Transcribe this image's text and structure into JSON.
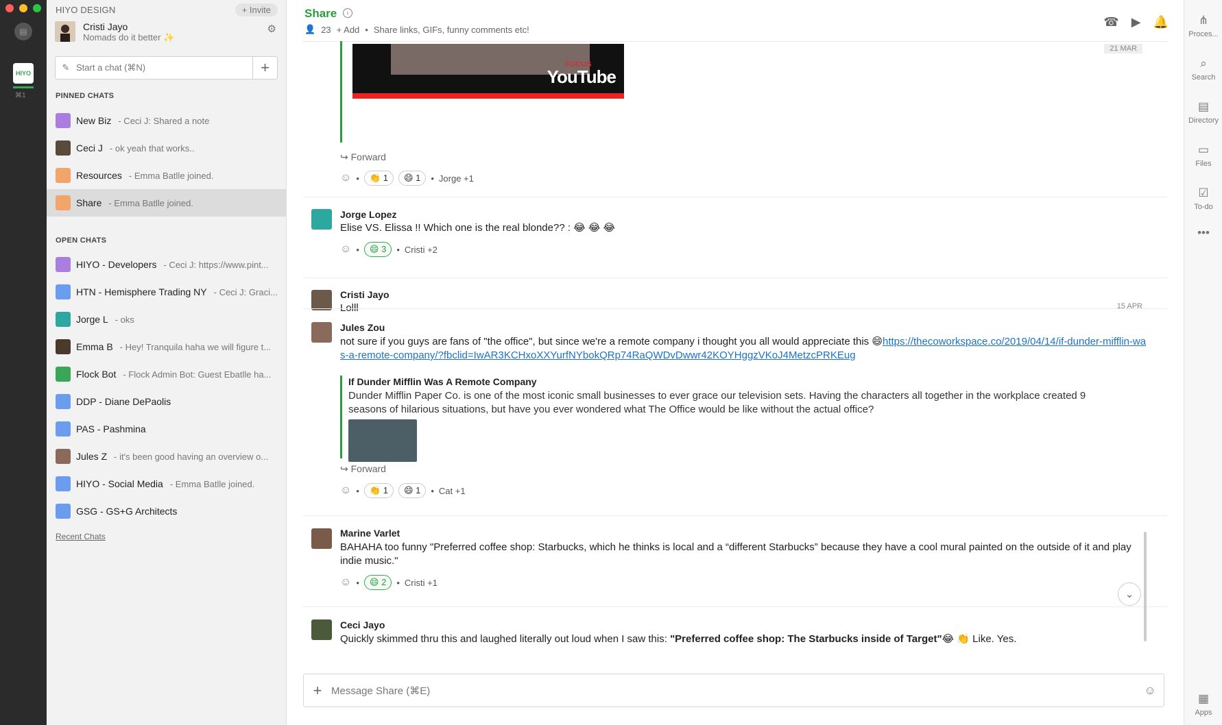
{
  "team": {
    "name": "HIYO DESIGN",
    "invite": "+ Invite",
    "shortcut": "⌘1"
  },
  "user": {
    "name": "Cristi Jayo",
    "status": "Nomads do it better ✨"
  },
  "start_chat": {
    "placeholder": "Start a chat (⌘N)"
  },
  "pinned": {
    "title": "PINNED CHATS",
    "items": [
      {
        "name": "New Biz",
        "preview": "- Ceci J: Shared a note",
        "color": "#a97ee0"
      },
      {
        "name": "Ceci J",
        "preview": "- ok yeah that works..",
        "color": "#5a4a3a"
      },
      {
        "name": "Resources",
        "preview": "- Emma Batlle joined.",
        "color": "#f2a56a"
      },
      {
        "name": "Share",
        "preview": "- Emma Batlle joined.",
        "color": "#f2a56a"
      }
    ]
  },
  "open": {
    "title": "OPEN CHATS",
    "items": [
      {
        "name": "HIYO - Developers",
        "preview": "- Ceci J: https://www.pint...",
        "color": "#a97ee0"
      },
      {
        "name": "HTN - Hemisphere Trading NY",
        "preview": "- Ceci J: Graci...",
        "color": "#6a9cf0"
      },
      {
        "name": "Jorge L",
        "preview": "- oks",
        "color": "#2ca8a0"
      },
      {
        "name": "Emma B",
        "preview": "- Hey! Tranquila haha we will figure t...",
        "color": "#4a3a2a"
      },
      {
        "name": "Flock Bot",
        "preview": "- Flock Admin Bot: Guest Ebatlle ha...",
        "color": "#3aa757"
      },
      {
        "name": "DDP - Diane DePaolis",
        "preview": "",
        "color": "#6a9cf0"
      },
      {
        "name": "PAS - Pashmina",
        "preview": "",
        "color": "#6a9cf0"
      },
      {
        "name": "Jules Z",
        "preview": "- it's been good having an overview o...",
        "color": "#8a6a5a"
      },
      {
        "name": "HIYO - Social Media",
        "preview": "- Emma Batlle joined.",
        "color": "#6a9cf0"
      },
      {
        "name": "GSG - GS+G Architects",
        "preview": "",
        "color": "#6a9cf0"
      }
    ],
    "recent": "Recent Chats"
  },
  "header": {
    "title": "Share",
    "members": "23",
    "add": "+ Add",
    "description": "Share links, GIFs, funny comments etc!"
  },
  "messages": {
    "yt": {
      "focus": "FOCUS",
      "logo": "YouTube",
      "date": "21 MAR",
      "forward": "Forward",
      "r1": "👏 1",
      "r2": "😄 1",
      "by": "Jorge +1"
    },
    "m1": {
      "author": "Jorge Lopez",
      "text": "Elise VS. Elissa !! Which one is the real blonde??  : 😂 😂 😂",
      "r1": "😄 3",
      "by": "Cristi +2"
    },
    "m2": {
      "author": "Cristi Jayo",
      "text": "Lolll",
      "date": "15 APR"
    },
    "m3": {
      "author": "Jules Zou",
      "text": "not sure if you guys are fans of \"the office\", but since we're a remote company i thought you all would appreciate this 😄",
      "link": "https://thecoworkspace.co/2019/04/14/if-dunder-mifflin-was-a-remote-company/?fbclid=IwAR3KCHxoXXYurfNYbokQRp74RaQWDvDwwr42KOYHggzVKoJ4MetzcPRKEug",
      "preview_title": "If Dunder Mifflin Was A Remote Company",
      "preview_desc": "Dunder Mifflin Paper Co. is one of the most iconic small businesses to ever grace our television sets. Having the characters all together in the workplace created 9 seasons of hilarious situations, but have you ever wondered what The Office would be like without the actual office?",
      "forward": "Forward",
      "r1": "👏 1",
      "r2": "😄 1",
      "by": "Cat +1"
    },
    "m4": {
      "author": "Marine Varlet",
      "text": "BAHAHA too funny \"Preferred coffee shop: Starbucks, which he thinks is local and a “different Starbucks” because they have a cool mural painted on the outside of it and play indie music.\"",
      "r1": "😄 2",
      "by": "Cristi +1"
    },
    "m5": {
      "author": "Ceci Jayo",
      "text_a": "Quickly skimmed thru this and laughed literally out loud when I saw this: ",
      "text_b": "\"Preferred coffee shop: The Starbucks inside of Target\"",
      "text_c": "😂 👏 Like. Yes."
    }
  },
  "composer": {
    "placeholder": "Message Share (⌘E)"
  },
  "apps": {
    "process": "Proces...",
    "search": "Search",
    "directory": "Directory",
    "files": "Files",
    "todo": "To-do",
    "more": "•••",
    "apps": "Apps"
  }
}
